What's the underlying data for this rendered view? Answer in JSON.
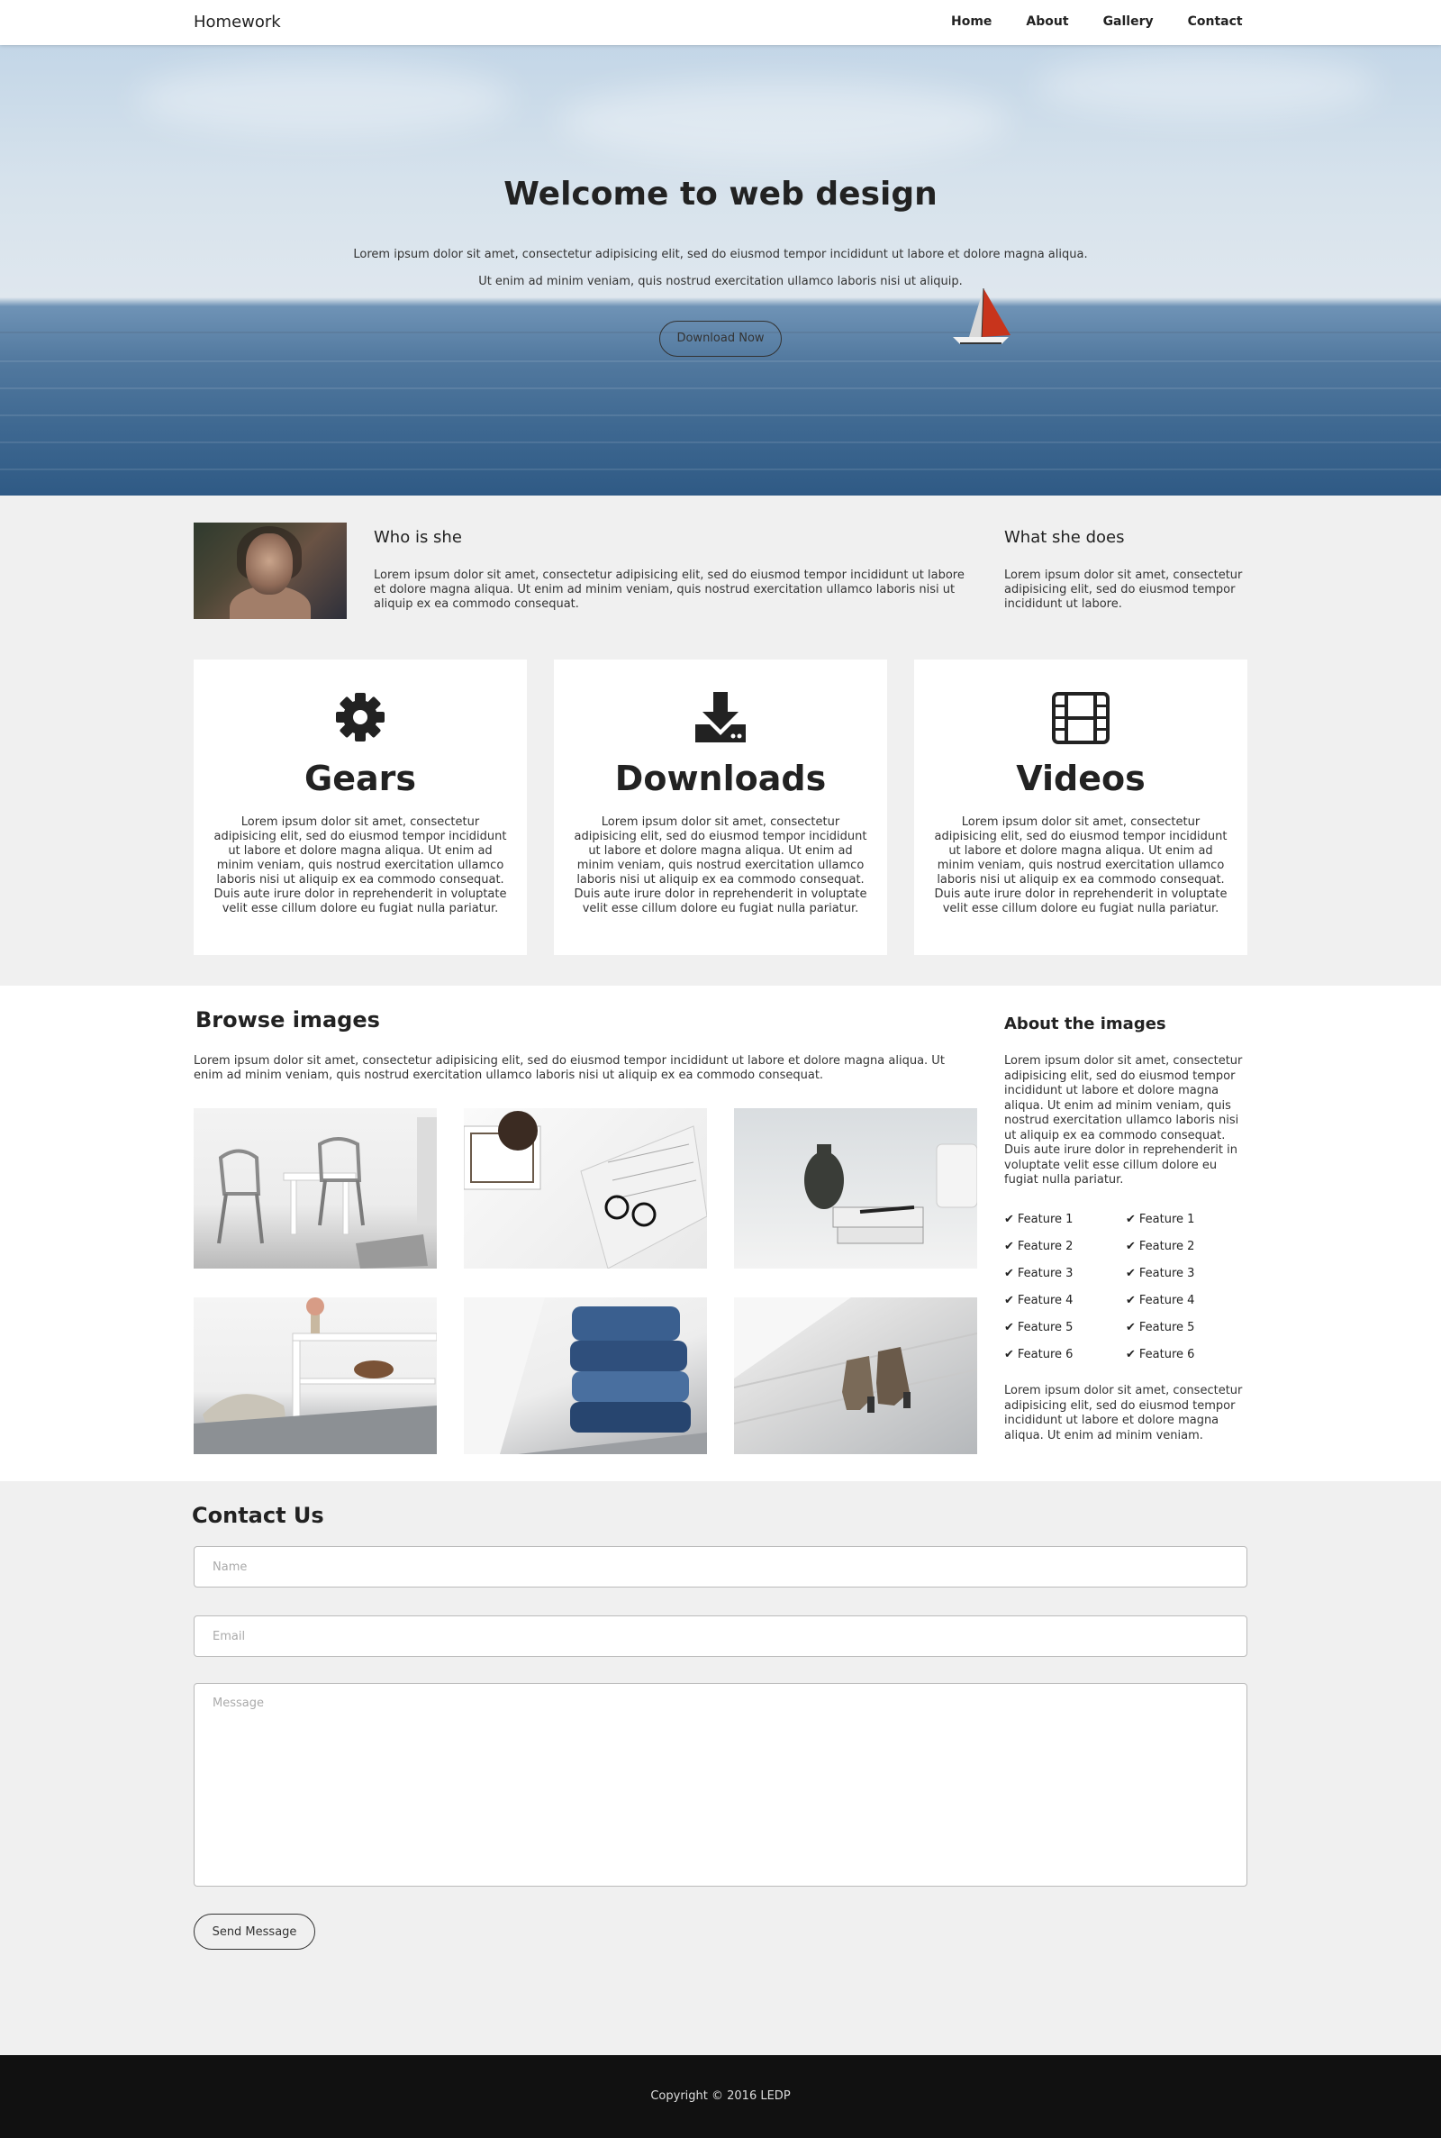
{
  "nav": {
    "brand": "Homework",
    "items": [
      "Home",
      "About",
      "Gallery",
      "Contact"
    ]
  },
  "hero": {
    "title": "Welcome to web design",
    "line1": "Lorem ipsum dolor sit amet, consectetur adipisicing elit, sed do eiusmod tempor incididunt ut labore et dolore magna aliqua.",
    "line2": "Ut enim ad minim veniam, quis nostrud exercitation ullamco laboris nisi ut aliquip.",
    "button": "Download Now"
  },
  "intro": {
    "who_title": "Who is she",
    "who_text": "Lorem ipsum dolor sit amet, consectetur adipisicing elit, sed do eiusmod tempor incididunt ut labore et dolore magna aliqua. Ut enim ad minim veniam, quis nostrud exercitation ullamco laboris nisi ut aliquip ex ea commodo consequat.",
    "what_title": "What she does",
    "what_text": "Lorem ipsum dolor sit amet, consectetur adipisicing elit, sed do eiusmod tempor incididunt ut labore."
  },
  "cards": [
    {
      "icon": "gear-icon",
      "title": "Gears",
      "text": "Lorem ipsum dolor sit amet, consectetur adipisicing elit, sed do eiusmod tempor incididunt ut labore et dolore magna aliqua. Ut enim ad minim veniam, quis nostrud exercitation ullamco laboris nisi ut aliquip ex ea commodo consequat. Duis aute irure dolor in reprehenderit in voluptate velit esse cillum dolore eu fugiat nulla pariatur."
    },
    {
      "icon": "download-icon",
      "title": "Downloads",
      "text": "Lorem ipsum dolor sit amet, consectetur adipisicing elit, sed do eiusmod tempor incididunt ut labore et dolore magna aliqua. Ut enim ad minim veniam, quis nostrud exercitation ullamco laboris nisi ut aliquip ex ea commodo consequat. Duis aute irure dolor in reprehenderit in voluptate velit esse cillum dolore eu fugiat nulla pariatur."
    },
    {
      "icon": "film-icon",
      "title": "Videos",
      "text": "Lorem ipsum dolor sit amet, consectetur adipisicing elit, sed do eiusmod tempor incididunt ut labore et dolore magna aliqua. Ut enim ad minim veniam, quis nostrud exercitation ullamco laboris nisi ut aliquip ex ea commodo consequat. Duis aute irure dolor in reprehenderit in voluptate velit esse cillum dolore eu fugiat nulla pariatur."
    }
  ],
  "browse": {
    "title": "Browse images",
    "text": "Lorem ipsum dolor sit amet, consectetur adipisicing elit, sed do eiusmod tempor incididunt ut labore et dolore magna aliqua. Ut enim ad minim veniam, quis nostrud exercitation ullamco laboris nisi ut aliquip ex ea commodo consequat."
  },
  "about": {
    "title": "About the images",
    "text": "Lorem ipsum dolor sit amet, consectetur adipisicing elit, sed do eiusmod tempor incididunt ut labore et dolore magna aliqua. Ut enim ad minim veniam, quis nostrud exercitation ullamco laboris nisi ut aliquip ex ea commodo consequat. Duis aute irure dolor in reprehenderit in voluptate velit esse cillum dolore eu fugiat nulla pariatur.",
    "features_left": [
      "Feature 1",
      "Feature 2",
      "Feature 3",
      "Feature 4",
      "Feature 5",
      "Feature 6"
    ],
    "features_right": [
      "Feature 1",
      "Feature 2",
      "Feature 3",
      "Feature 4",
      "Feature 5",
      "Feature 6"
    ],
    "footer_text": "Lorem ipsum dolor sit amet, consectetur adipisicing elit, sed do eiusmod tempor incididunt ut labore et dolore magna aliqua. Ut enim ad minim veniam."
  },
  "contact": {
    "title": "Contact Us",
    "name_placeholder": "Name",
    "email_placeholder": "Email",
    "message_placeholder": "Message",
    "send": "Send Message"
  },
  "footer": {
    "copyright": "Copyright © 2016 LEDP"
  }
}
